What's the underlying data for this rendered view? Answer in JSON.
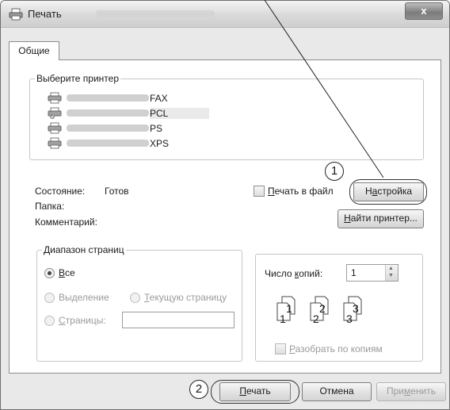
{
  "window": {
    "title": "Печать",
    "close_label": "x"
  },
  "tabs": [
    {
      "label": "Общие"
    }
  ],
  "printer_group": {
    "legend": "Выберите принтер",
    "printers": [
      {
        "name": "FAX",
        "icon": "fax-printer-icon"
      },
      {
        "name": "PCL",
        "icon": "printer-check-icon"
      },
      {
        "name": "PS",
        "icon": "printer-icon"
      },
      {
        "name": "XPS",
        "icon": "printer-icon"
      }
    ]
  },
  "status": {
    "state_label": "Состояние:",
    "state_value": "Готов",
    "folder_label": "Папка:",
    "comment_label": "Комментарий:"
  },
  "print_to_file": {
    "pre": "",
    "accel": "П",
    "post": "ечать в файл"
  },
  "settings_button": {
    "pre": "Н",
    "accel": "а",
    "post": "стройка"
  },
  "find_printer_button": {
    "pre": "",
    "accel": "Н",
    "post": "айти принтер..."
  },
  "page_range": {
    "legend": "Диапазон страниц",
    "all": {
      "pre": "",
      "accel": "В",
      "post": "се"
    },
    "selection": {
      "pre": "Вы",
      "accel": "д",
      "post": "еление"
    },
    "current": {
      "pre": "",
      "accel": "Т",
      "post": "екущую страницу"
    },
    "pages": {
      "pre": "",
      "accel": "С",
      "post": "траницы:"
    },
    "pages_value": ""
  },
  "copies": {
    "label_pre": "Число ",
    "label_accel": "к",
    "label_post": "опий:",
    "value": "1",
    "collate_pre": "",
    "collate_accel": "Р",
    "collate_post": "азобрать по копиям",
    "collate_glyphs": [
      {
        "big": "1",
        "small": "1"
      },
      {
        "big": "2",
        "small": "2"
      },
      {
        "big": "3",
        "small": "3"
      }
    ]
  },
  "callouts": {
    "one": "1",
    "two": "2"
  },
  "footer": {
    "print_pre": "",
    "print_accel": "П",
    "print_post": "ечать",
    "cancel": "Отмена",
    "apply_pre": "При",
    "apply_accel": "м",
    "apply_post": "енить"
  }
}
